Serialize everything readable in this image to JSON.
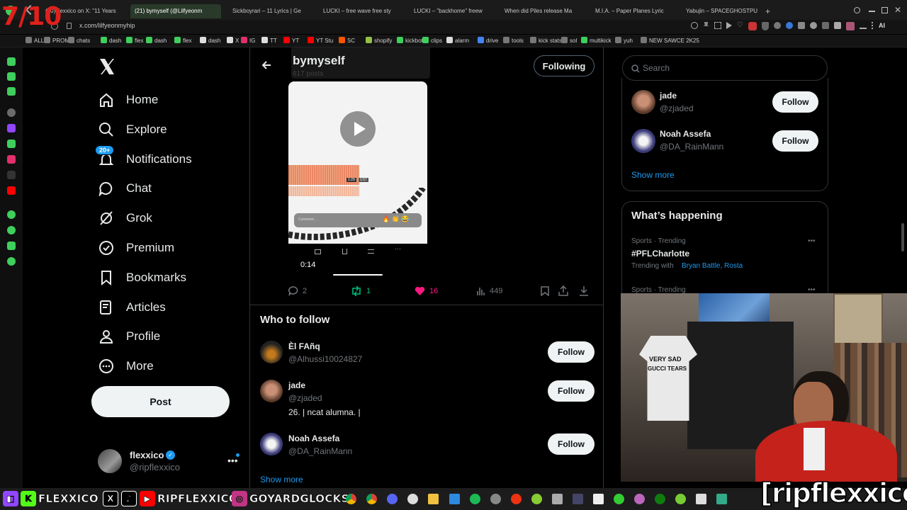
{
  "overlay": {
    "score": "7/10",
    "watermark": "[ripflexxico]"
  },
  "browser": {
    "tabs": [
      {
        "label": "(20) flexxico on X: \"11 Years",
        "active": false
      },
      {
        "label": "(21) bymyself (@Lilfyeonm",
        "active": true
      },
      {
        "label": "Sickboyrari – 11 Lyrics | Ge",
        "active": false
      },
      {
        "label": "LUCKI – free wave free sty",
        "active": false
      },
      {
        "label": "LUCKI – \"backhome\" freew",
        "active": false
      },
      {
        "label": "When did Piles release Ma",
        "active": false
      },
      {
        "label": "M.I.A. – Paper Planes Lyric",
        "active": false
      },
      {
        "label": "Yabujin – SPACEGHOSTPU",
        "active": false
      }
    ],
    "new_tab": "+",
    "url": "x.com/lilfyeonmyhip",
    "bookmarks": [
      "ALL",
      "PROMO",
      "chats",
      "dash",
      "flex",
      "dash",
      "flex",
      "dash",
      "X",
      "IG",
      "TT",
      "YT",
      "YT Stu",
      "SC",
      "shopify",
      "kickbot",
      "clips",
      "alarm",
      "drive",
      "tools",
      "kick stats",
      "sol",
      "multikick",
      "yuh",
      "NEW SAWCE 2K25"
    ],
    "bookmark_colors": [
      "#777",
      "#777",
      "#777",
      "#3ecf5c",
      "#3ecf5c",
      "#3ecf5c",
      "#3ecf5c",
      "#ddd",
      "#ddd",
      "#e1306c",
      "#ddd",
      "#ff0000",
      "#ff0000",
      "#ff5500",
      "#95bf47",
      "#3ecf5c",
      "#3ecf5c",
      "#ddd",
      "#4285f4",
      "#777",
      "#777",
      "#777",
      "#3ecf5c",
      "#777",
      "#777"
    ],
    "ai_label": "AI"
  },
  "nav": {
    "items": [
      {
        "label": "Home",
        "icon": "home-icon"
      },
      {
        "label": "Explore",
        "icon": "search-icon"
      },
      {
        "label": "Notifications",
        "icon": "bell-icon",
        "badge": "20+"
      },
      {
        "label": "Chat",
        "icon": "chat-icon"
      },
      {
        "label": "Grok",
        "icon": "grok-icon"
      },
      {
        "label": "Premium",
        "icon": "premium-icon"
      },
      {
        "label": "Bookmarks",
        "icon": "bookmark-icon"
      },
      {
        "label": "Articles",
        "icon": "articles-icon"
      },
      {
        "label": "Profile",
        "icon": "profile-icon"
      },
      {
        "label": "More",
        "icon": "more-icon"
      }
    ],
    "post_label": "Post",
    "account": {
      "name": "flexxico",
      "handle": "@ripflexxico"
    }
  },
  "header": {
    "title": "bymyself",
    "subtitle": "617 posts",
    "following_label": "Following"
  },
  "video": {
    "time": "0:14",
    "inner_time_a": "1:29",
    "inner_time_b": "1:57",
    "comment_placeholder": "Comment..."
  },
  "actions": {
    "replies": "2",
    "reposts": "1",
    "likes": "16",
    "views": "449"
  },
  "who_to_follow": {
    "title": "Who to follow",
    "users": [
      {
        "name": "Èl FAñq",
        "handle": "@Alhussi10024827",
        "bio": "",
        "button": "Follow"
      },
      {
        "name": "jade",
        "handle": "@zjaded",
        "bio": "26. | ncat alumna. |",
        "button": "Follow"
      },
      {
        "name": "Noah Assefa",
        "handle": "@DA_RainMann",
        "bio": "",
        "button": "Follow"
      }
    ],
    "show_more": "Show more"
  },
  "right": {
    "search_placeholder": "Search",
    "suggested": [
      {
        "name": "jade",
        "handle": "@zjaded",
        "button": "Follow"
      },
      {
        "name": "Noah Assefa",
        "handle": "@DA_RainMann",
        "button": "Follow"
      }
    ],
    "show_more": "Show more",
    "happening": {
      "title": "What’s happening",
      "trends": [
        {
          "meta": "Sports · Trending",
          "tag": "#PFLCharlotte",
          "with_prefix": "Trending with",
          "with": "Bryan Battle, Rosta"
        },
        {
          "meta": "Sports · Trending"
        }
      ]
    }
  },
  "webcam": {
    "shirt_text_1": "VERY SAD",
    "shirt_text_2": "GUCCI TEARS"
  },
  "taskbar": {
    "socials": [
      {
        "letter": "K",
        "label": "FLEXXICO",
        "color": "#53fc18"
      },
      {
        "letter": "X",
        "label": "",
        "color": "#000000"
      },
      {
        "letter": "♪",
        "label": "",
        "color": "#000000"
      },
      {
        "letter": "▶",
        "label": "RIPFLEXXICO",
        "color": "#ff0000"
      },
      {
        "letter": "◎",
        "label": "GOYARDGLOCKS",
        "color": "#c13584"
      }
    ]
  },
  "colors": {
    "accent": "#1d9bf0",
    "like": "#f91880",
    "repost": "#00ba7c",
    "follow_bg": "#eff3f4",
    "score": "#e0201c"
  }
}
